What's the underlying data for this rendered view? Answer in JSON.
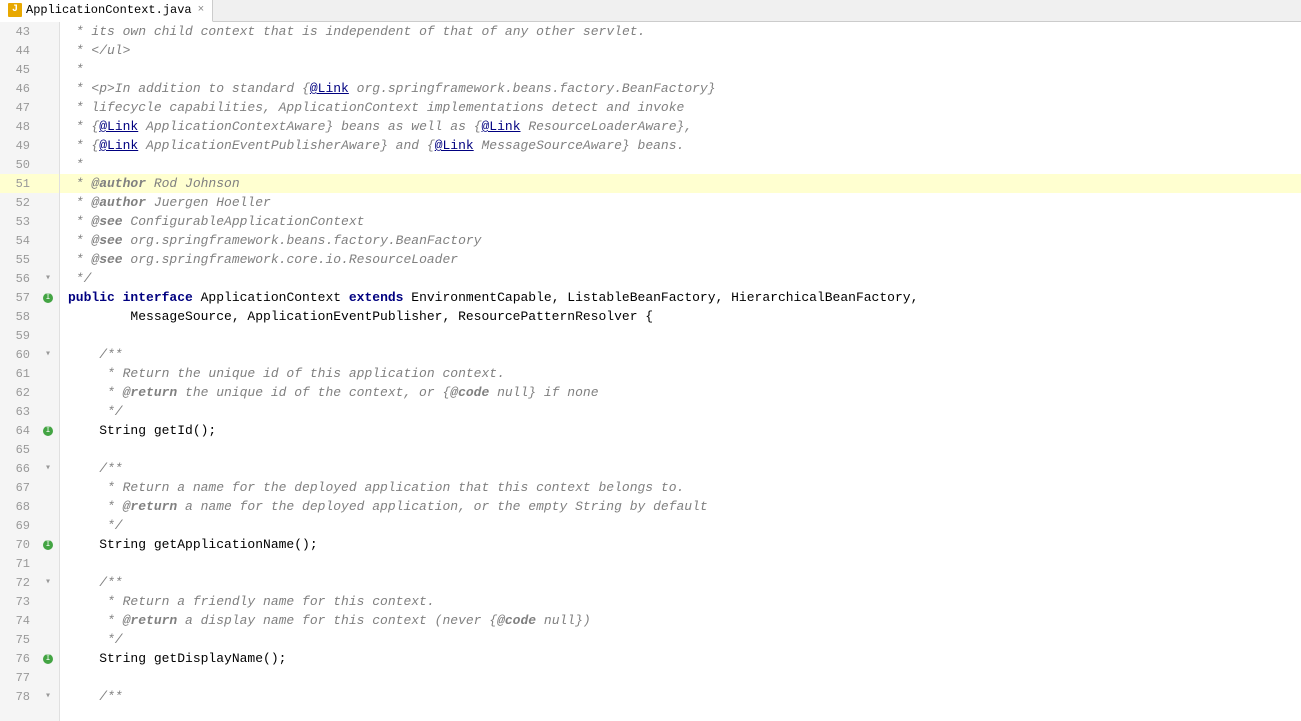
{
  "tab": {
    "filename": "ApplicationContext.java",
    "icon": "J"
  },
  "lines": [
    {
      "num": 43,
      "fold": false,
      "method": false,
      "highlighted": false,
      "content": [
        {
          "t": " * its own child context ",
          "c": "cm"
        },
        {
          "t": "that",
          "c": "cm"
        },
        {
          "t": " is independent of ",
          "c": "cm"
        },
        {
          "t": "that",
          "c": "cm"
        },
        {
          "t": " of any other servlet.",
          "c": "cm"
        }
      ]
    },
    {
      "num": 44,
      "fold": false,
      "method": false,
      "highlighted": false,
      "content": [
        {
          "t": " * </ul>",
          "c": "cm"
        }
      ]
    },
    {
      "num": 45,
      "fold": false,
      "method": false,
      "highlighted": false,
      "content": [
        {
          "t": " *",
          "c": "cm"
        }
      ]
    },
    {
      "num": 46,
      "fold": false,
      "method": false,
      "highlighted": false,
      "content": [
        {
          "t": " * <p>In addition to standard {",
          "c": "cm"
        },
        {
          "t": "@Link",
          "c": "link"
        },
        {
          "t": " org.springframework.beans.factory.BeanFactory}",
          "c": "cm"
        }
      ]
    },
    {
      "num": 47,
      "fold": false,
      "method": false,
      "highlighted": false,
      "content": [
        {
          "t": " * lifecycle capabilities, ApplicationContext implementations detect and invoke",
          "c": "cm"
        }
      ]
    },
    {
      "num": 48,
      "fold": false,
      "method": false,
      "highlighted": false,
      "content": [
        {
          "t": " * {",
          "c": "cm"
        },
        {
          "t": "@Link",
          "c": "link"
        },
        {
          "t": " ApplicationContextAware} beans as well as {",
          "c": "cm"
        },
        {
          "t": "@Link",
          "c": "link"
        },
        {
          "t": " ResourceLoaderAware},",
          "c": "cm"
        }
      ]
    },
    {
      "num": 49,
      "fold": false,
      "method": false,
      "highlighted": false,
      "content": [
        {
          "t": " * {",
          "c": "cm"
        },
        {
          "t": "@Link",
          "c": "link"
        },
        {
          "t": " ApplicationEventPublisherAware} and {",
          "c": "cm"
        },
        {
          "t": "@Link",
          "c": "link"
        },
        {
          "t": " MessageSourceAware} beans.",
          "c": "cm"
        }
      ]
    },
    {
      "num": 50,
      "fold": false,
      "method": false,
      "highlighted": false,
      "content": [
        {
          "t": " *",
          "c": "cm"
        }
      ]
    },
    {
      "num": 51,
      "fold": false,
      "method": false,
      "highlighted": true,
      "content": [
        {
          "t": " * ",
          "c": "cm"
        },
        {
          "t": "@author",
          "c": "anno-kw"
        },
        {
          "t": " Rod Johnson",
          "c": "cm"
        }
      ]
    },
    {
      "num": 52,
      "fold": false,
      "method": false,
      "highlighted": false,
      "content": [
        {
          "t": " * ",
          "c": "cm"
        },
        {
          "t": "@author",
          "c": "anno-kw"
        },
        {
          "t": " Juergen Hoeller",
          "c": "cm"
        }
      ]
    },
    {
      "num": 53,
      "fold": false,
      "method": false,
      "highlighted": false,
      "content": [
        {
          "t": " * ",
          "c": "cm"
        },
        {
          "t": "@see",
          "c": "anno-kw"
        },
        {
          "t": " ConfigurableApplicationContext",
          "c": "cm"
        }
      ]
    },
    {
      "num": 54,
      "fold": false,
      "method": false,
      "highlighted": false,
      "content": [
        {
          "t": " * ",
          "c": "cm"
        },
        {
          "t": "@see",
          "c": "anno-kw"
        },
        {
          "t": " org.springframework.beans.factory.BeanFactory",
          "c": "cm"
        }
      ]
    },
    {
      "num": 55,
      "fold": false,
      "method": false,
      "highlighted": false,
      "content": [
        {
          "t": " * ",
          "c": "cm"
        },
        {
          "t": "@see",
          "c": "anno-kw"
        },
        {
          "t": " org.springframework.core.io.ResourceLoader",
          "c": "cm"
        }
      ]
    },
    {
      "num": 56,
      "fold": true,
      "method": false,
      "highlighted": false,
      "content": [
        {
          "t": " */",
          "c": "cm"
        }
      ]
    },
    {
      "num": 57,
      "fold": false,
      "method": true,
      "highlighted": false,
      "content": [
        {
          "t": "public ",
          "c": "kw"
        },
        {
          "t": "interface ",
          "c": "kw"
        },
        {
          "t": "ApplicationContext ",
          "c": "class-name"
        },
        {
          "t": "extends ",
          "c": "kw"
        },
        {
          "t": "EnvironmentCapable, ListableBeanFactory, HierarchicalBeanFactory,",
          "c": "normal"
        }
      ]
    },
    {
      "num": 58,
      "fold": false,
      "method": false,
      "highlighted": false,
      "content": [
        {
          "t": "        MessageSource, ApplicationEventPublisher, ResourcePatternResolver {",
          "c": "normal"
        }
      ]
    },
    {
      "num": 59,
      "fold": false,
      "method": false,
      "highlighted": false,
      "content": []
    },
    {
      "num": 60,
      "fold": true,
      "method": false,
      "highlighted": false,
      "content": [
        {
          "t": "    /**",
          "c": "cm"
        }
      ]
    },
    {
      "num": 61,
      "fold": false,
      "method": false,
      "highlighted": false,
      "content": [
        {
          "t": "     * Return the unique id of this application context.",
          "c": "cm"
        }
      ]
    },
    {
      "num": 62,
      "fold": false,
      "method": false,
      "highlighted": false,
      "content": [
        {
          "t": "     * ",
          "c": "cm"
        },
        {
          "t": "@return",
          "c": "anno-kw"
        },
        {
          "t": " the unique id of the context, or {",
          "c": "cm"
        },
        {
          "t": "@code",
          "c": "anno-kw"
        },
        {
          "t": " null} if none",
          "c": "cm"
        }
      ]
    },
    {
      "num": 63,
      "fold": false,
      "method": false,
      "highlighted": false,
      "content": [
        {
          "t": "     */",
          "c": "cm"
        }
      ]
    },
    {
      "num": 64,
      "fold": false,
      "method": true,
      "highlighted": false,
      "content": [
        {
          "t": "    String getId();",
          "c": "normal"
        }
      ]
    },
    {
      "num": 65,
      "fold": false,
      "method": false,
      "highlighted": false,
      "content": []
    },
    {
      "num": 66,
      "fold": true,
      "method": false,
      "highlighted": false,
      "content": [
        {
          "t": "    /**",
          "c": "cm"
        }
      ]
    },
    {
      "num": 67,
      "fold": false,
      "method": false,
      "highlighted": false,
      "content": [
        {
          "t": "     * Return a name for the deployed application that this context belongs to.",
          "c": "cm"
        }
      ]
    },
    {
      "num": 68,
      "fold": false,
      "method": false,
      "highlighted": false,
      "content": [
        {
          "t": "     * ",
          "c": "cm"
        },
        {
          "t": "@return",
          "c": "anno-kw"
        },
        {
          "t": " a name for the deployed application, or the empty String by default",
          "c": "cm"
        }
      ]
    },
    {
      "num": 69,
      "fold": false,
      "method": false,
      "highlighted": false,
      "content": [
        {
          "t": "     */",
          "c": "cm"
        }
      ]
    },
    {
      "num": 70,
      "fold": false,
      "method": true,
      "highlighted": false,
      "content": [
        {
          "t": "    String getApplicationName();",
          "c": "normal"
        }
      ]
    },
    {
      "num": 71,
      "fold": false,
      "method": false,
      "highlighted": false,
      "content": []
    },
    {
      "num": 72,
      "fold": true,
      "method": false,
      "highlighted": false,
      "content": [
        {
          "t": "    /**",
          "c": "cm"
        }
      ]
    },
    {
      "num": 73,
      "fold": false,
      "method": false,
      "highlighted": false,
      "content": [
        {
          "t": "     * Return a friendly name for this context.",
          "c": "cm"
        }
      ]
    },
    {
      "num": 74,
      "fold": false,
      "method": false,
      "highlighted": false,
      "content": [
        {
          "t": "     * ",
          "c": "cm"
        },
        {
          "t": "@return",
          "c": "anno-kw"
        },
        {
          "t": " a display name for this context (never {",
          "c": "cm"
        },
        {
          "t": "@code",
          "c": "anno-kw"
        },
        {
          "t": " null})",
          "c": "cm"
        }
      ]
    },
    {
      "num": 75,
      "fold": false,
      "method": false,
      "highlighted": false,
      "content": [
        {
          "t": "     */",
          "c": "cm"
        }
      ]
    },
    {
      "num": 76,
      "fold": false,
      "method": true,
      "highlighted": false,
      "content": [
        {
          "t": "    String getDisplayName();",
          "c": "normal"
        }
      ]
    },
    {
      "num": 77,
      "fold": false,
      "method": false,
      "highlighted": false,
      "content": []
    },
    {
      "num": 78,
      "fold": true,
      "method": false,
      "highlighted": false,
      "content": [
        {
          "t": "    /**",
          "c": "cm"
        }
      ]
    }
  ]
}
